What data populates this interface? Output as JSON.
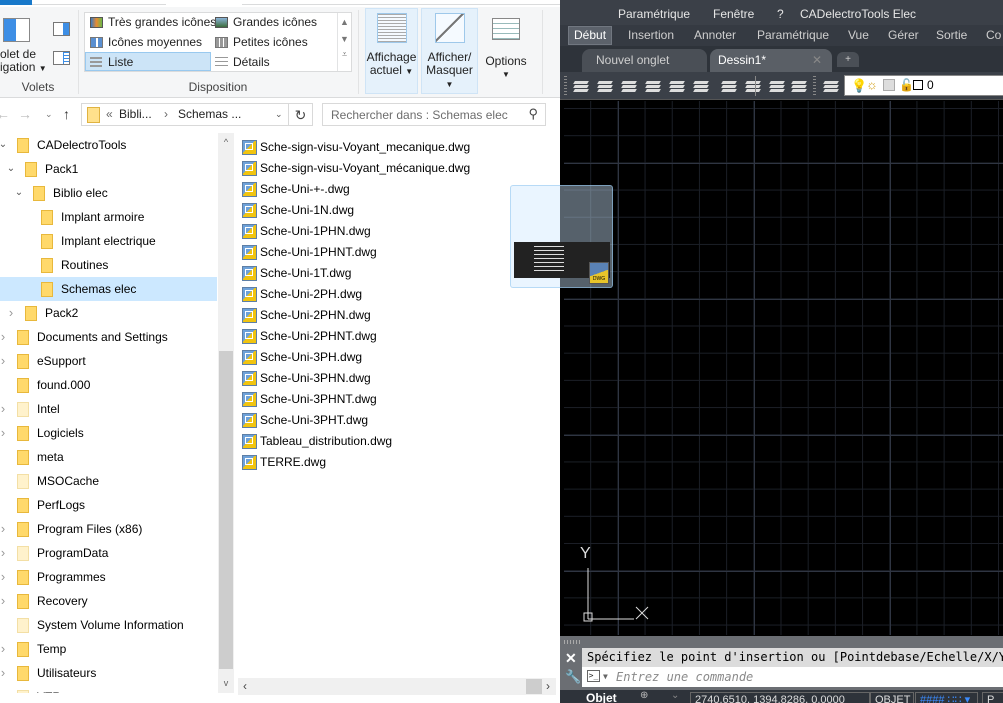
{
  "explorer": {
    "ribbon": {
      "panes_group": {
        "nav_pane_label_line1": "olet de",
        "nav_pane_label_line2": "igation",
        "group_label": "Volets"
      },
      "layout_group": {
        "items": [
          {
            "label": "Très grandes icônes",
            "icon": "extra-large-icons-icon"
          },
          {
            "label": "Grandes icônes",
            "icon": "large-icons-icon"
          },
          {
            "label": "Icônes moyennes",
            "icon": "medium-icons-icon"
          },
          {
            "label": "Petites icônes",
            "icon": "small-icons-icon"
          },
          {
            "label": "Liste",
            "icon": "list-icon",
            "selected": true
          },
          {
            "label": "Détails",
            "icon": "details-icon"
          }
        ],
        "group_label": "Disposition"
      },
      "current_view": {
        "line1": "Affichage",
        "line2": "actuel"
      },
      "show_hide": {
        "line1": "Afficher/",
        "line2": "Masquer"
      },
      "options": {
        "label": "Options"
      }
    },
    "address": {
      "crumbs": [
        "Bibli...",
        "Schemas ..."
      ],
      "overflow": "«",
      "separator": "›",
      "search_placeholder": "Rechercher dans : Schemas elec"
    },
    "tree": [
      {
        "label": "CADelectroTools",
        "expanded": true,
        "level": 0
      },
      {
        "label": "Pack1",
        "expanded": true,
        "level": 1
      },
      {
        "label": "Biblio elec",
        "expanded": true,
        "level": 2
      },
      {
        "label": "Implant armoire",
        "level": 3
      },
      {
        "label": "Implant electrique",
        "level": 3
      },
      {
        "label": "Routines",
        "level": 3
      },
      {
        "label": "Schemas elec",
        "level": 3,
        "selected": true
      },
      {
        "label": "Pack2",
        "collapsed": true,
        "level": 1
      },
      {
        "label": "Documents and Settings",
        "collapsed": true,
        "level": 0,
        "shortcut": true
      },
      {
        "label": "eSupport",
        "collapsed": true,
        "level": 0
      },
      {
        "label": "found.000",
        "level": 0
      },
      {
        "label": "Intel",
        "collapsed": true,
        "level": 0,
        "hidden": true
      },
      {
        "label": "Logiciels",
        "collapsed": true,
        "level": 0
      },
      {
        "label": "meta",
        "level": 0
      },
      {
        "label": "MSOCache",
        "level": 0,
        "hidden": true
      },
      {
        "label": "PerfLogs",
        "level": 0
      },
      {
        "label": "Program Files (x86)",
        "collapsed": true,
        "level": 0
      },
      {
        "label": "ProgramData",
        "collapsed": true,
        "level": 0,
        "hidden": true
      },
      {
        "label": "Programmes",
        "collapsed": true,
        "level": 0
      },
      {
        "label": "Recovery",
        "collapsed": true,
        "level": 0
      },
      {
        "label": "System Volume Information",
        "level": 0,
        "hidden": true
      },
      {
        "label": "Temp",
        "collapsed": true,
        "level": 0
      },
      {
        "label": "Utilisateurs",
        "collapsed": true,
        "level": 0
      },
      {
        "label": "VTRoot",
        "collapsed": true,
        "level": 0,
        "hidden": true
      }
    ],
    "files": [
      "Sche-sign-visu-Voyant_mecanique.dwg",
      "Sche-sign-visu-Voyant_mécanique.dwg",
      "Sche-Uni-+-.dwg",
      "Sche-Uni-1N.dwg",
      "Sche-Uni-1PHN.dwg",
      "Sche-Uni-1PHNT.dwg",
      "Sche-Uni-1T.dwg",
      "Sche-Uni-2PH.dwg",
      "Sche-Uni-2PHN.dwg",
      "Sche-Uni-2PHNT.dwg",
      "Sche-Uni-3PH.dwg",
      "Sche-Uni-3PHN.dwg",
      "Sche-Uni-3PHNT.dwg",
      "Sche-Uni-3PHT.dwg",
      "Tableau_distribution.dwg",
      "TERRE.dwg"
    ],
    "drag_ghost_badge": "DWG"
  },
  "autocad": {
    "menu": [
      "Paramétrique",
      "Fenêtre",
      "?",
      "CADelectroTools Elec"
    ],
    "ribbon_tabs": [
      {
        "label": "Début",
        "active": true
      },
      {
        "label": "Insertion"
      },
      {
        "label": "Annoter"
      },
      {
        "label": "Paramétrique"
      },
      {
        "label": "Vue"
      },
      {
        "label": "Gérer"
      },
      {
        "label": "Sortie"
      },
      {
        "label": "Co"
      }
    ],
    "doc_tabs": [
      {
        "label": "Nouvel onglet"
      },
      {
        "label": "Dessin1*",
        "active": true
      }
    ],
    "layer_combo_value": "0",
    "ucs": {
      "x_label": "X",
      "y_label": "Y"
    },
    "command_history": "Spécifiez le point d'insertion ou [Pointdebase/Echelle/X/Y/Z",
    "command_placeholder": "Entrez une commande",
    "status": {
      "layout_tab": "Objet",
      "coordinates": "2740.6510, 1394.8286, 0.0000",
      "model_button": "OBJET",
      "p_label": "P"
    }
  }
}
